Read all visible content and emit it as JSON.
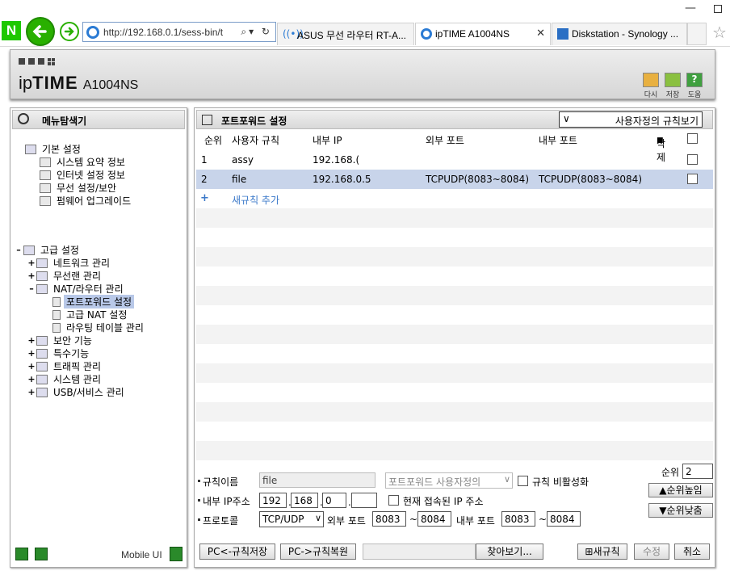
{
  "browser": {
    "url": "http://192.168.0.1/sess-bin/t",
    "tabs": [
      {
        "label": "ASUS 무선 라우터 RT-A..."
      },
      {
        "label": "ipTIME A1004NS"
      },
      {
        "label": "Diskstation - Synology ..."
      }
    ]
  },
  "header": {
    "brand_ip": "ip",
    "brand_time": "TIME",
    "model": "A1004NS",
    "buttons": [
      {
        "label": "다시"
      },
      {
        "label": "저장"
      },
      {
        "label": "도움"
      }
    ]
  },
  "sidebar": {
    "title": "메뉴탐색기",
    "basic": {
      "label": "기본 설정",
      "items": [
        "시스템 요약 정보",
        "인터넷 설정 정보",
        "무선 설정/보안",
        "펌웨어 업그레이드"
      ]
    },
    "advanced": {
      "label": "고급 설정",
      "items": [
        {
          "label": "네트워크 관리"
        },
        {
          "label": "무선랜 관리"
        },
        {
          "label": "NAT/라우터 관리"
        },
        {
          "label": "포트포워드 설정"
        },
        {
          "label": "고급 NAT 설정"
        },
        {
          "label": "라우팅 테이블 관리"
        },
        {
          "label": "보안 기능"
        },
        {
          "label": "특수기능"
        },
        {
          "label": "트래픽 관리"
        },
        {
          "label": "시스템 관리"
        },
        {
          "label": "USB/서비스 관리"
        }
      ]
    },
    "footer": {
      "mobile_label": "Mobile UI"
    }
  },
  "main": {
    "title": "포트포워드 설정",
    "view_select": "사용자정의 규칙보기",
    "columns": [
      "순위",
      "사용자 규칙",
      "내부 IP",
      "외부 포트",
      "내부 포트",
      "삭제"
    ],
    "rows": [
      {
        "rank": "1",
        "rule": "assy",
        "ip": "192.168.(",
        "ext": "",
        "int": ""
      },
      {
        "rank": "2",
        "rule": "file",
        "ip": "192.168.0.5",
        "ext": "TCPUDP(8083~8084)",
        "int": "TCPUDP(8083~8084)"
      }
    ],
    "add_rule": "새규칙 추가"
  },
  "form": {
    "rule_name_label": "규칙이름",
    "rule_name": "file",
    "rule_type": "포트포워드 사용자정의",
    "disable_label": "규칙 비활성화",
    "rank_label": "순위",
    "rank": "2",
    "ip_label": "내부 IP주소",
    "ip1": "192",
    "ip2": "168",
    "ip3": "0",
    "current_ip_label": "현재 접속된 IP 주소",
    "up_label": "순위높임",
    "protocol_label": "프로토콜",
    "protocol": "TCP/UDP",
    "ext_port_label": "외부 포트",
    "ext_from": "8083",
    "ext_to": "8084",
    "int_port_label": "내부 포트",
    "int_from": "8083",
    "int_to": "8084",
    "tilde": "~",
    "down_label": "순위낮춤",
    "save_pc": "PC<-규칙저장",
    "restore_pc": "PC->규칙복원",
    "browse": "찾아보기...",
    "new_rule": "새규칙",
    "modify": "수정",
    "cancel": "취소"
  }
}
